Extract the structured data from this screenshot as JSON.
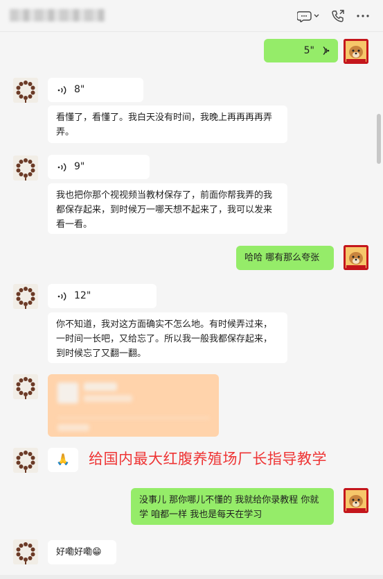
{
  "header": {
    "chat_icon": "chat-bubble-icon",
    "call_icon": "phone-call-icon",
    "more_icon": "more-dots-icon"
  },
  "messages": [
    {
      "side": "right",
      "kind": "voice",
      "text": "5\""
    },
    {
      "side": "left",
      "kind": "voice",
      "text": "8\""
    },
    {
      "side": "left",
      "kind": "text",
      "text": "看懂了，看懂了。我白天没有时间，我晚上再再再再弄弄。"
    },
    {
      "side": "left",
      "kind": "voice",
      "text": "9\""
    },
    {
      "side": "left",
      "kind": "text",
      "text": "我也把你那个视视频当教材保存了，前面你帮我弄的我都保存起来，到时候万一哪天想不起来了，我可以发来看一看。"
    },
    {
      "side": "right",
      "kind": "text",
      "text": "哈哈 哪有那么夸张"
    },
    {
      "side": "left",
      "kind": "voice",
      "text": "12\""
    },
    {
      "side": "left",
      "kind": "text",
      "text": "你不知道，我对这方面确实不怎么地。有时候弄过来，一时间一长吧，又给忘了。所以我一般我都保存起来，到时候忘了又翻一翻。"
    },
    {
      "side": "left",
      "kind": "card",
      "text": ""
    },
    {
      "side": "left",
      "kind": "emoji",
      "text": "🙏"
    },
    {
      "side": "right",
      "kind": "text",
      "text": "没事儿 那你哪儿不懂的 我就给你录教程  你就学  咱都一样 我也是每天在学习"
    },
    {
      "side": "left",
      "kind": "text",
      "text": "好嘞好嘞😁"
    }
  ],
  "annotation": "给国内最大红腹养殖场厂长指导教学",
  "colors": {
    "self_bubble": "#95ec69",
    "other_bubble": "#ffffff",
    "annotation": "#ee3434",
    "background": "#f5f5f5"
  }
}
